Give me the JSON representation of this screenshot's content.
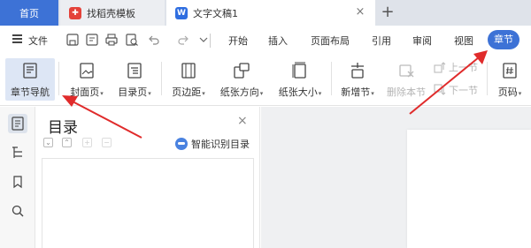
{
  "tabs": {
    "home": "首页",
    "template": "找稻壳模板",
    "document": "文字文稿1",
    "close": "×",
    "add": "+"
  },
  "menu": {
    "file": "文件",
    "items": [
      "开始",
      "插入",
      "页面布局",
      "引用",
      "审阅",
      "视图"
    ],
    "active": "章节"
  },
  "ribbon": {
    "chapter_nav": "章节导航",
    "cover_page": "封面页",
    "toc_page": "目录页",
    "margins": "页边距",
    "orientation": "纸张方向",
    "paper_size": "纸张大小",
    "new_section": "新增节",
    "delete_section": "删除本节",
    "prev_section": "上一节",
    "next_section": "下一节",
    "page_number": "页码",
    "caret": "▾"
  },
  "panel": {
    "title": "目录",
    "close": "×",
    "smart_toc": "智能识别目录"
  },
  "colors": {
    "accent": "#3d72d6",
    "arrow": "#e02b2b",
    "tab_bar": "#dfe3ea",
    "doc_background": "#eff0f2"
  },
  "icons": [
    "wps-writer-icon",
    "daoke-icon",
    "hamburger-icon",
    "save-icon",
    "print-icon",
    "undo-icon",
    "redo-icon",
    "outline-icon",
    "bookmark-icon",
    "search-icon"
  ]
}
